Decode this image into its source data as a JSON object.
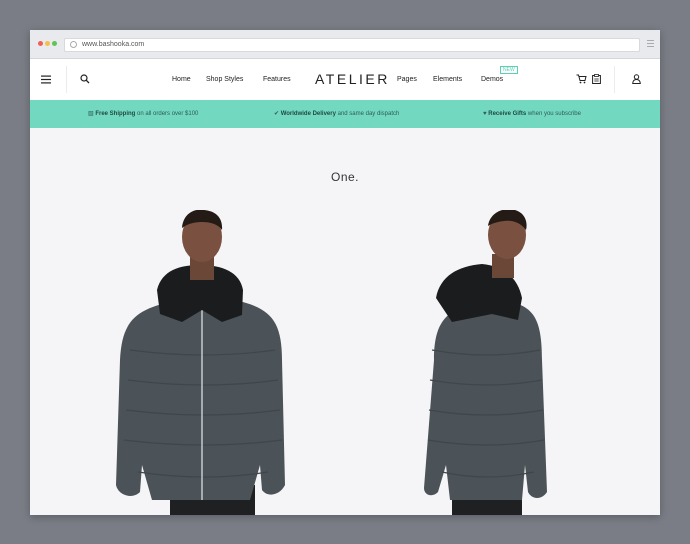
{
  "browser": {
    "url": "www.bashooka.com"
  },
  "nav": {
    "left_links": [
      "Home",
      "Shop Styles",
      "Features"
    ],
    "logo": "ATELIER",
    "right_links": [
      "Pages",
      "Elements",
      "Demos"
    ],
    "demos_badge": "NEW"
  },
  "promo": {
    "items": [
      {
        "bold": "Free Shipping",
        "rest": " on all orders over $100"
      },
      {
        "bold": "Worldwide Delivery",
        "rest": " and same day dispatch"
      },
      {
        "bold": "Receive Gifts",
        "rest": " when you subscribe"
      }
    ]
  },
  "main": {
    "headline": "One."
  },
  "icons": {
    "hamburger": "hamburger-menu-icon",
    "search": "search-icon",
    "cart": "shopping-cart-icon",
    "wishlist": "wishlist-icon",
    "account": "user-account-icon"
  },
  "colors": {
    "accent": "#72d8c0",
    "jacket": "#4b5258",
    "background": "#7a7d86"
  }
}
